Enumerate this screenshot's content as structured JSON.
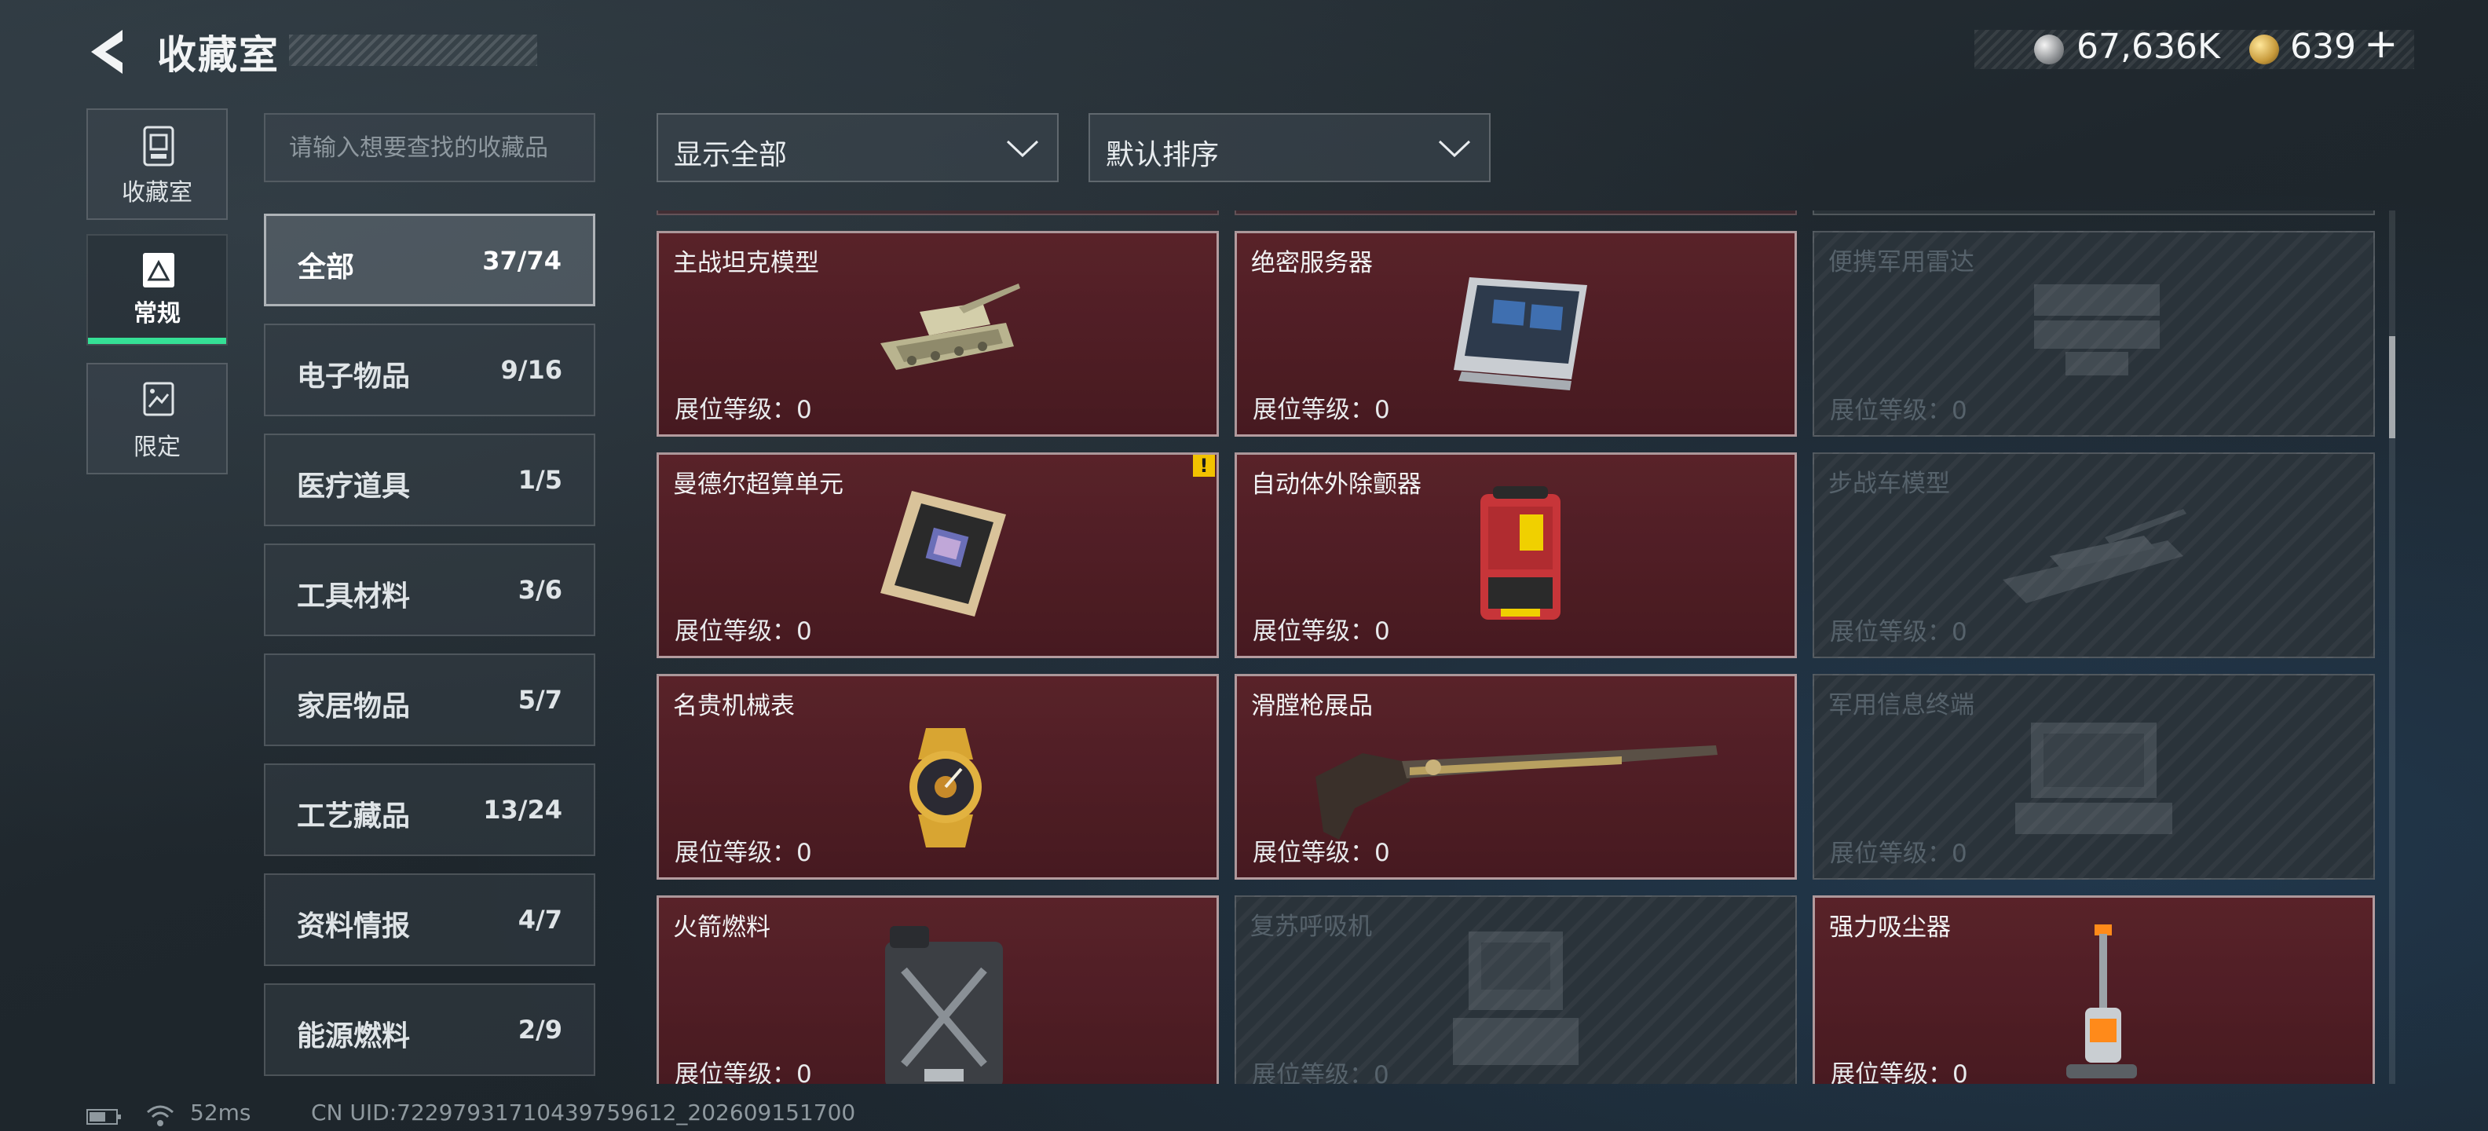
{
  "header": {
    "title": "收藏室",
    "silver_amount": "67,636K",
    "gold_amount": "639",
    "gold_plus": "+"
  },
  "side_tabs": [
    {
      "label": "收藏室",
      "icon": "collection-cabinet-icon"
    },
    {
      "label": "常规",
      "icon": "regular-frame-icon",
      "active": true
    },
    {
      "label": "限定",
      "icon": "limited-frame-icon"
    }
  ],
  "search": {
    "placeholder": "请输入想要查找的收藏品"
  },
  "categories": [
    {
      "name": "全部",
      "count": "37/74",
      "active": true
    },
    {
      "name": "电子物品",
      "count": "9/16"
    },
    {
      "name": "医疗道具",
      "count": "1/5"
    },
    {
      "name": "工具材料",
      "count": "3/6"
    },
    {
      "name": "家居物品",
      "count": "5/7"
    },
    {
      "name": "工艺藏品",
      "count": "13/24"
    },
    {
      "name": "资料情报",
      "count": "4/7"
    },
    {
      "name": "能源燃料",
      "count": "2/9"
    }
  ],
  "filters": {
    "show_label": "显示全部",
    "sort_label": "默认排序"
  },
  "items": [
    {
      "name": "主战坦克模型",
      "level": "展位等级：0",
      "owned": true,
      "icon": "tank-model-icon"
    },
    {
      "name": "绝密服务器",
      "level": "展位等级：0",
      "owned": true,
      "icon": "server-icon"
    },
    {
      "name": "便携军用雷达",
      "level": "展位等级：0",
      "owned": false,
      "icon": "radar-icon"
    },
    {
      "name": "曼德尔超算单元",
      "level": "展位等级：0",
      "owned": true,
      "icon": "supercomputer-unit-icon",
      "alert": "!"
    },
    {
      "name": "自动体外除颤器",
      "level": "展位等级：0",
      "owned": true,
      "icon": "defibrillator-icon"
    },
    {
      "name": "步战车模型",
      "level": "展位等级：0",
      "owned": false,
      "icon": "ifv-model-icon"
    },
    {
      "name": "名贵机械表",
      "level": "展位等级：0",
      "owned": true,
      "icon": "mechanical-watch-icon"
    },
    {
      "name": "滑膛枪展品",
      "level": "展位等级：0",
      "owned": true,
      "icon": "musket-icon"
    },
    {
      "name": "军用信息终端",
      "level": "展位等级：0",
      "owned": false,
      "icon": "military-terminal-icon"
    },
    {
      "name": "火箭燃料",
      "level": "展位等级：0",
      "owned": true,
      "icon": "fuel-canister-icon"
    },
    {
      "name": "复苏呼吸机",
      "level": "展位等级：0",
      "owned": false,
      "icon": "ventilator-icon"
    },
    {
      "name": "强力吸尘器",
      "level": "展位等级：0",
      "owned": true,
      "icon": "vacuum-cleaner-icon"
    }
  ],
  "status": {
    "ping": "52ms",
    "uid": "CN UID:7229793171043975961​2_202609151700"
  },
  "colors": {
    "owned_card_bg": "#4e1c23",
    "locked_card_bg": "#2a333a",
    "active_tab_accent": "#35e096",
    "alert_badge": "#f2c200"
  }
}
